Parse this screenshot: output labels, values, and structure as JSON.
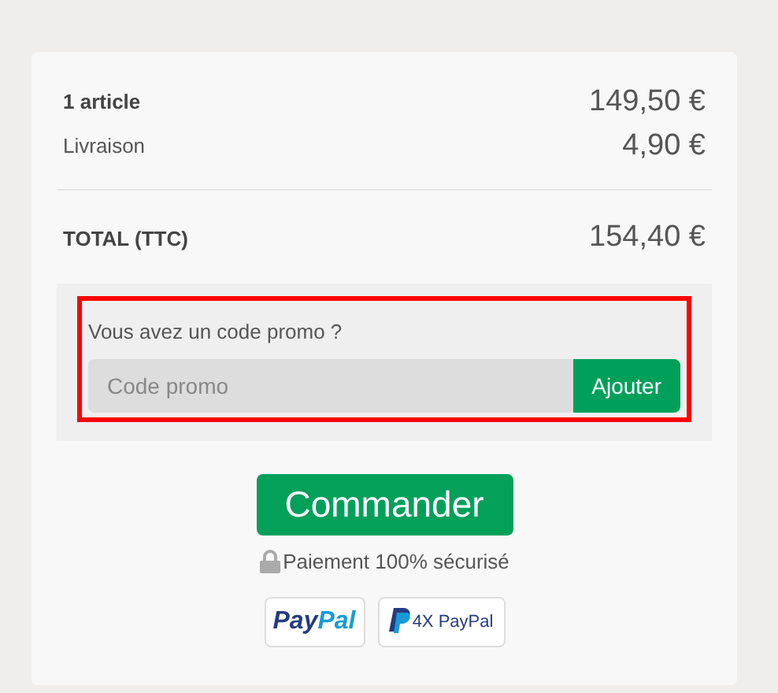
{
  "summary": {
    "lines": [
      {
        "kind": "bold",
        "label": "1 article",
        "amount": "149,50 €"
      },
      {
        "kind": "plain",
        "label": "Livraison",
        "amount": "4,90 €"
      }
    ],
    "total": {
      "label": "TOTAL (TTC)",
      "amount": "154,40 €"
    }
  },
  "promo": {
    "question": "Vous avez un code promo ?",
    "placeholder": "Code promo",
    "button": "Ajouter"
  },
  "checkout": {
    "button": "Commander",
    "secure_note": "Paiement 100% sécurisé"
  },
  "payment_logos": [
    {
      "kind": "paypal",
      "text_1": "Pay",
      "text_2": "Pal"
    },
    {
      "kind": "paypal4x",
      "text": "4X PayPal"
    }
  ]
}
